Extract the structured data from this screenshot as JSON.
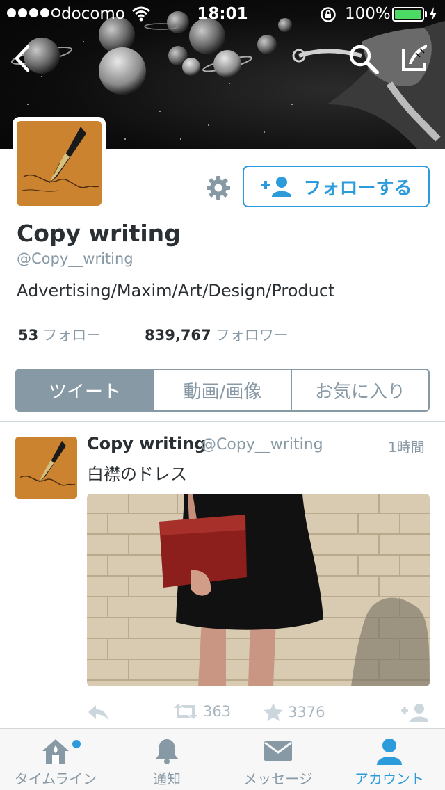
{
  "status_bar": {
    "carrier": "docomo",
    "time": "18:01",
    "battery": "100%",
    "signal_bars": 4
  },
  "header": {
    "back_icon": "chevron-left-icon",
    "search_icon": "search-icon",
    "compose_icon": "compose-icon"
  },
  "profile": {
    "name": "Copy writing",
    "handle": "@Copy__writing",
    "bio": "Advertising/Maxim/Art/Design/Product",
    "follow_button": "フォローする",
    "following_count": "53",
    "following_label": "フォロー",
    "followers_count": "839,767",
    "followers_label": "フォロワー"
  },
  "tabs": [
    {
      "label": "ツイート",
      "active": true
    },
    {
      "label": "動画/画像",
      "active": false
    },
    {
      "label": "お気に入り",
      "active": false
    }
  ],
  "tweet": {
    "name": "Copy writing",
    "handle": "@Copy__writing",
    "time": "1時間",
    "text": "白襟のドレス",
    "retweets": "363",
    "favorites": "3376"
  },
  "tabbar": [
    {
      "label": "タイムライン",
      "icon": "home-icon",
      "active": false
    },
    {
      "label": "通知",
      "icon": "bell-icon",
      "active": false
    },
    {
      "label": "メッセージ",
      "icon": "envelope-icon",
      "active": false
    },
    {
      "label": "アカウント",
      "icon": "person-icon",
      "active": true
    }
  ],
  "colors": {
    "accent": "#2b9bdb",
    "tab_active_bg": "#8899a6",
    "battery": "#4cd964"
  }
}
